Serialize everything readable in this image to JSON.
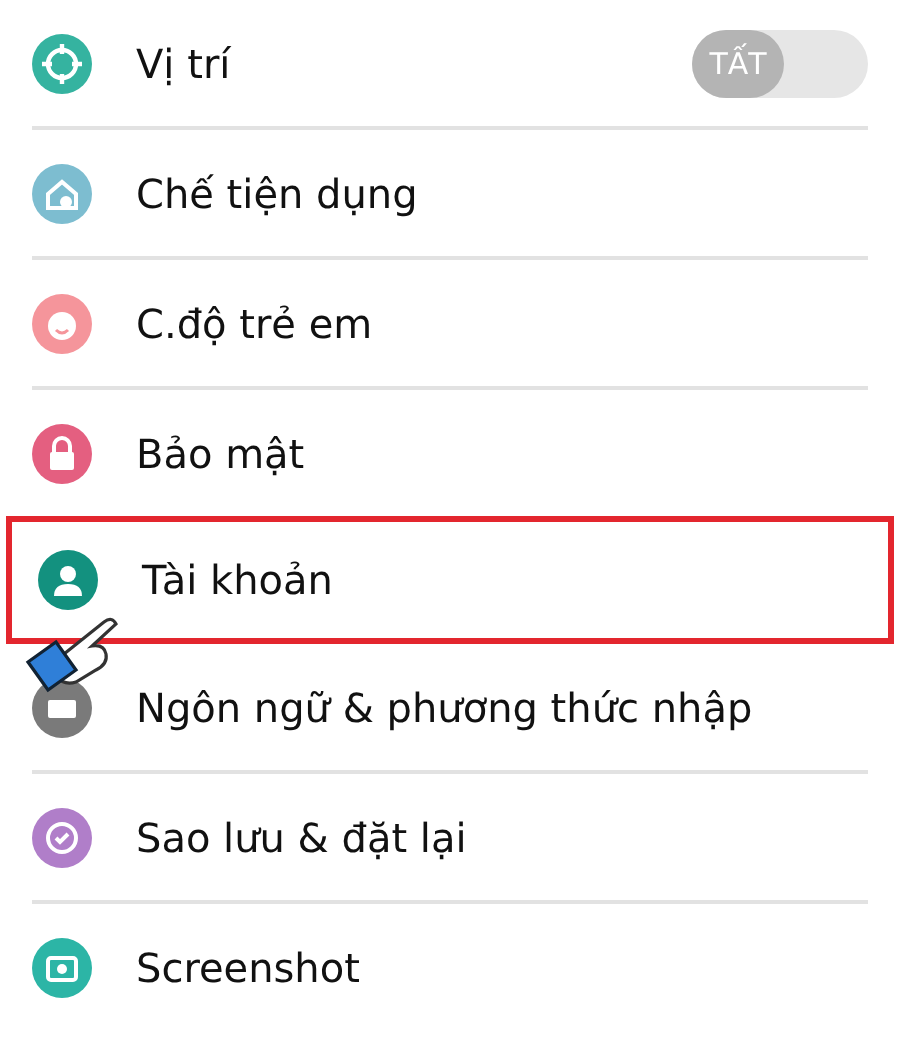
{
  "settings_items": [
    {
      "label": "Vị trí",
      "color": "#35b3a0",
      "kind": "toggle",
      "toggle": {
        "label": "TẤT",
        "on": false
      },
      "highlighted": false
    },
    {
      "label": "Chế tiện dụng",
      "color": "#7dbdd0",
      "kind": "plain",
      "highlighted": false
    },
    {
      "label": "C.độ trẻ em",
      "color": "#f5959b",
      "kind": "plain",
      "highlighted": false
    },
    {
      "label": "Bảo mật",
      "color": "#e45f80",
      "kind": "plain",
      "highlighted": false
    },
    {
      "label": "Tài khoản",
      "color": "#13917f",
      "kind": "plain",
      "highlighted": true
    },
    {
      "label": "Ngôn ngữ & phương thức nhập",
      "color": "#7a7a7a",
      "kind": "plain",
      "highlighted": false
    },
    {
      "label": "Sao lưu & đặt lại",
      "color": "#b07ec9",
      "kind": "plain",
      "highlighted": false
    },
    {
      "label": "Screenshot",
      "color": "#2cb5a6",
      "kind": "plain",
      "highlighted": false
    }
  ]
}
